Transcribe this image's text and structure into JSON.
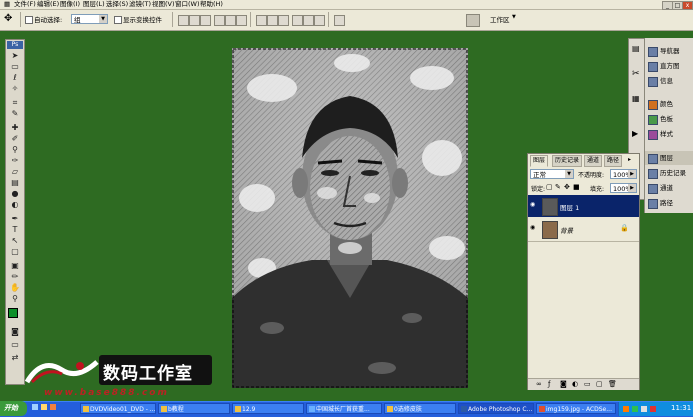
{
  "colors": {
    "workspace": "#2e6b22",
    "menu_bg": "#ece9d8",
    "taskbar": "#245edb",
    "selected_layer": "#0a246a"
  },
  "menu": {
    "items": [
      "文件(F)",
      "编辑(E)",
      "图像(I)",
      "图层(L)",
      "选择(S)",
      "滤镜(T)",
      "视图(V)",
      "窗口(W)",
      "帮助(H)"
    ]
  },
  "window_controls": {
    "min": "_",
    "max": "□",
    "close": "x"
  },
  "options_bar": {
    "auto_select_label": "自动选择:",
    "auto_select_value": "组",
    "show_transform_label": "显示变换控件",
    "workspace_button": "工作区"
  },
  "dock": {
    "panel_a": [
      {
        "label": "导航器",
        "icon": "navigator-icon"
      },
      {
        "label": "直方图",
        "icon": "histogram-icon"
      },
      {
        "label": "信息",
        "icon": "info-icon"
      }
    ],
    "panel_b": [
      {
        "label": "颜色",
        "icon": "color-icon"
      },
      {
        "label": "色板",
        "icon": "swatches-icon"
      },
      {
        "label": "样式",
        "icon": "styles-icon"
      }
    ],
    "panel_c": [
      {
        "label": "图层",
        "icon": "layers-icon"
      },
      {
        "label": "历史记录",
        "icon": "history-icon"
      },
      {
        "label": "通道",
        "icon": "channels-icon"
      },
      {
        "label": "路径",
        "icon": "paths-icon"
      }
    ]
  },
  "layers_panel": {
    "tabs": [
      "图层",
      "历史记录",
      "通道",
      "路径"
    ],
    "blend_mode": "正常",
    "opacity_label": "不透明度:",
    "opacity_value": "100%",
    "lock_label": "锁定:",
    "fill_label": "填充:",
    "fill_value": "100%",
    "layers": [
      {
        "name": "图层 1",
        "selected": true
      },
      {
        "name": "背景",
        "selected": false,
        "locked": true
      }
    ]
  },
  "logo": {
    "text": "数码工作室",
    "url": "www.base888.com"
  },
  "taskbar": {
    "start": "开始",
    "tasks": [
      {
        "label": "DVDVideo01_DVD - ..."
      },
      {
        "label": "b教程"
      },
      {
        "label": "12.9"
      },
      {
        "label": "中国城长厂首获重..."
      },
      {
        "label": "0选修皮肤"
      },
      {
        "label": "Adobe Photoshop C..."
      },
      {
        "label": "img159.jpg - ACDSe..."
      }
    ],
    "clock": "11:31"
  },
  "tools_label": "Ps"
}
